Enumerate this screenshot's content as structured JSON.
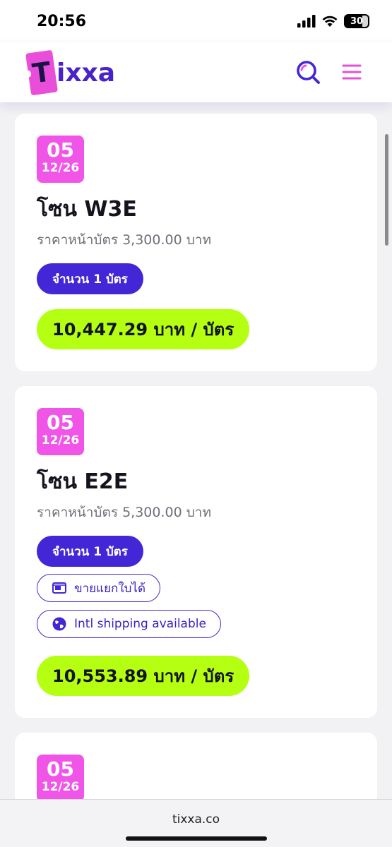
{
  "status_bar": {
    "time": "20:56",
    "battery": "30",
    "icons": [
      "signal-icon",
      "wifi-icon",
      "battery-icon"
    ]
  },
  "header": {
    "logo_initial": "T",
    "logo_rest": "ixxa",
    "icons": [
      "search-icon",
      "menu-icon"
    ]
  },
  "colors": {
    "brand_purple": "#4326d6",
    "brand_pink": "#f155e8",
    "price_green": "#b5ff12"
  },
  "listings": [
    {
      "date_day": "05",
      "date_month_year": "12/26",
      "zone": "โซน W3E",
      "face_price": "ราคาหน้าบัตร 3,300.00 บาท",
      "quantity": "จำนวน 1 บัตร",
      "tags": [],
      "price": "10,447.29 บาท / บัตร"
    },
    {
      "date_day": "05",
      "date_month_year": "12/26",
      "zone": "โซน E2E",
      "face_price": "ราคาหน้าบัตร 5,300.00 บาท",
      "quantity": "จำนวน 1 บัตร",
      "tags": [
        {
          "icon": "ticket-split-icon",
          "label": "ขายแยกใบได้"
        },
        {
          "icon": "globe-icon",
          "label": "Intl shipping available"
        }
      ],
      "price": "10,553.89 บาท / บัตร"
    },
    {
      "date_day": "05",
      "date_month_year": "12/26"
    }
  ],
  "browser": {
    "url": "tixxa.co"
  }
}
